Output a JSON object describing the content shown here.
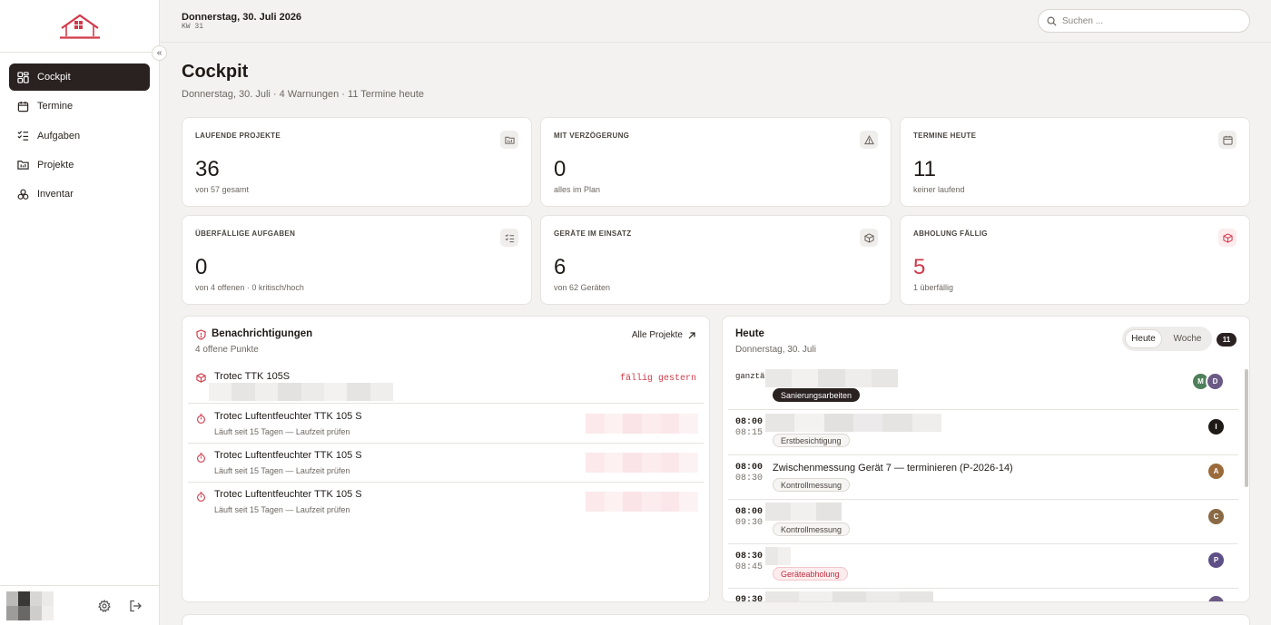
{
  "app": {
    "nav": [
      {
        "label": "Cockpit",
        "icon": "dashboard-icon",
        "active": true
      },
      {
        "label": "Termine",
        "icon": "calendar-icon",
        "active": false
      },
      {
        "label": "Aufgaben",
        "icon": "checklist-icon",
        "active": false
      },
      {
        "label": "Projekte",
        "icon": "folder-icon",
        "active": false
      },
      {
        "label": "Inventar",
        "icon": "boxes-icon",
        "active": false
      }
    ],
    "collapse_glyph": "«"
  },
  "topbar": {
    "date": "Donnerstag, 30. Juli 2026",
    "week": "KW 31",
    "search_placeholder": "Suchen ..."
  },
  "header": {
    "title": "Cockpit",
    "subtitle": "Donnerstag, 30. Juli · 4 Warnungen · 11 Termine heute"
  },
  "stats": [
    {
      "label": "LAUFENDE PROJEKTE",
      "value": "36",
      "sub": "von 57 gesamt",
      "icon": "folder-icon",
      "accent": false
    },
    {
      "label": "MIT VERZÖGERUNG",
      "value": "0",
      "sub": "alles im Plan",
      "icon": "warning-icon",
      "accent": false
    },
    {
      "label": "TERMINE HEUTE",
      "value": "11",
      "sub": "keiner laufend",
      "icon": "calendar-icon",
      "accent": false
    },
    {
      "label": "ÜBERFÄLLIGE AUFGABEN",
      "value": "0",
      "sub": "von 4 offenen · 0 kritisch/hoch",
      "icon": "checklist-icon",
      "accent": false
    },
    {
      "label": "GERÄTE IM EINSATZ",
      "value": "6",
      "sub": "von 62 Geräten",
      "icon": "box-icon",
      "accent": false
    },
    {
      "label": "ABHOLUNG FÄLLIG",
      "value": "5",
      "sub": "1 überfällig",
      "icon": "box-icon",
      "accent": true
    }
  ],
  "notifications": {
    "title": "Benachrichtigungen",
    "subtitle": "4 offene Punkte",
    "link": "Alle Projekte",
    "items": [
      {
        "title": "Trotec TTK 105S",
        "detail": "",
        "badge": "fällig gestern",
        "icon": "box-icon"
      },
      {
        "title": "Trotec Luftentfeuchter TTK 105 S",
        "detail": "Läuft seit 15 Tagen — Laufzeit prüfen",
        "badge": "",
        "icon": "timer-icon"
      },
      {
        "title": "Trotec Luftentfeuchter TTK 105 S",
        "detail": "Läuft seit 15 Tagen — Laufzeit prüfen",
        "badge": "",
        "icon": "timer-icon"
      },
      {
        "title": "Trotec Luftentfeuchter TTK 105 S",
        "detail": "Läuft seit 15 Tagen — Laufzeit prüfen",
        "badge": "",
        "icon": "timer-icon"
      }
    ]
  },
  "today": {
    "title": "Heute",
    "subtitle": "Donnerstag, 30. Juli",
    "toggle": [
      "Heute",
      "Woche"
    ],
    "count": "11",
    "events": [
      {
        "time": "ganztäg",
        "end": "",
        "title": "",
        "tag": "Sanierungsarbeiten",
        "tag_style": "dark",
        "avatars": [
          {
            "i": "M",
            "c": "#4f7f5a"
          },
          {
            "i": "D",
            "c": "#6b5a86"
          }
        ]
      },
      {
        "time": "08:00",
        "end": "08:15",
        "title": "",
        "tag": "Erstbesichtigung",
        "tag_style": "light",
        "avatars": [
          {
            "i": "I",
            "c": "#1f1a17"
          }
        ]
      },
      {
        "time": "08:00",
        "end": "08:30",
        "title": "Zwischenmessung Gerät 7 — terminieren (P-2026-14)",
        "tag": "Kontrollmessung",
        "tag_style": "light",
        "avatars": [
          {
            "i": "A",
            "c": "#9a6a3a"
          }
        ]
      },
      {
        "time": "08:00",
        "end": "09:30",
        "title": "",
        "tag": "Kontrollmessung",
        "tag_style": "light",
        "avatars": [
          {
            "i": "C",
            "c": "#8a6a44"
          }
        ]
      },
      {
        "time": "08:30",
        "end": "08:45",
        "title": "",
        "tag": "Geräteabholung",
        "tag_style": "red",
        "avatars": [
          {
            "i": "P",
            "c": "#5e4f86"
          }
        ]
      },
      {
        "time": "09:30",
        "end": "",
        "title": "",
        "tag": "",
        "tag_style": "light",
        "avatars": [
          {
            "i": "",
            "c": "#6b5a86"
          }
        ]
      }
    ]
  },
  "colors": {
    "accent": "#d23a4a",
    "dark": "#2a2220",
    "background": "#f3f2f0"
  }
}
